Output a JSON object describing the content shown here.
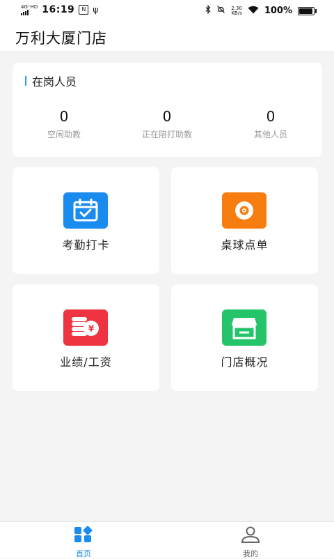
{
  "status_bar": {
    "network": "4G⁺HD",
    "time": "16:19",
    "nfc_badge": "N",
    "usb_symbol": "ψ",
    "speed_value": "2.30",
    "speed_unit": "KB/s",
    "battery_text": "100%",
    "battery_level": 1.0
  },
  "header": {
    "title": "万利大厦门店"
  },
  "staff_card": {
    "title": "在岗人员",
    "accent_color": "#1fa0e8",
    "stats": [
      {
        "value": "0",
        "label": "空闲助教"
      },
      {
        "value": "0",
        "label": "正在陪打助教"
      },
      {
        "value": "0",
        "label": "其他人员"
      }
    ]
  },
  "tiles": [
    {
      "label": "考勤打卡",
      "icon": "calendar-check-icon",
      "color": "#1a8cf0"
    },
    {
      "label": "桌球点单",
      "icon": "billiard-ball-icon",
      "color": "#f77d10"
    },
    {
      "label": "业绩/工资",
      "icon": "coin-stack-yen-icon",
      "color": "#ee3440",
      "symbol": "¥"
    },
    {
      "label": "门店概况",
      "icon": "storefront-icon",
      "color": "#25c46a"
    }
  ],
  "tab_bar": {
    "active_color": "#1a8cf0",
    "inactive_color": "#666666",
    "items": [
      {
        "label": "首页",
        "icon": "home-grid-icon",
        "active": true
      },
      {
        "label": "我的",
        "icon": "user-icon",
        "active": false
      }
    ]
  }
}
